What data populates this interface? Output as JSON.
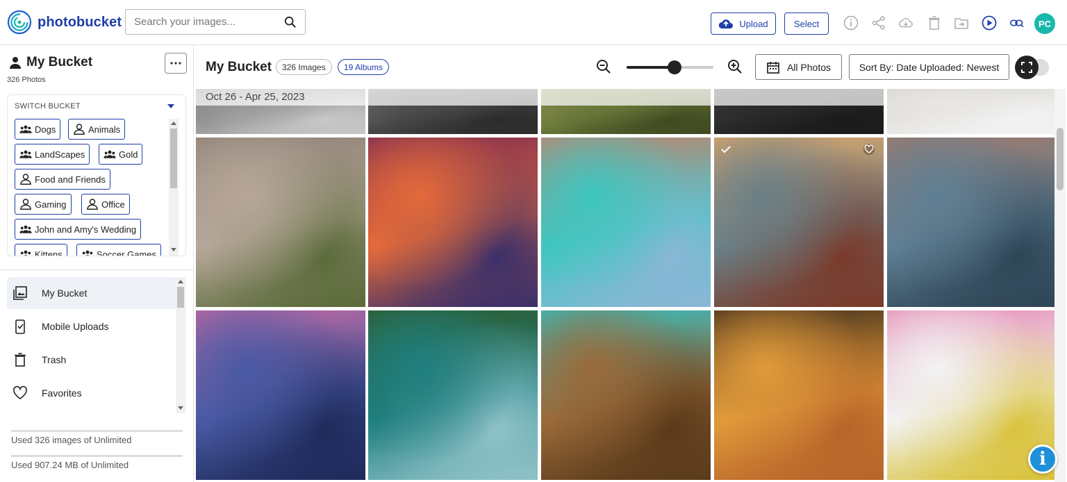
{
  "header": {
    "brand": "photobucket",
    "search_placeholder": "Search your images...",
    "upload_label": "Upload",
    "select_label": "Select",
    "avatar_initials": "PC",
    "toolbar_icons": [
      "info-icon",
      "share-icon",
      "download-icon",
      "trash-icon",
      "move-to-album-icon",
      "slideshow-icon",
      "link-icon"
    ],
    "brand_color": "#1e3fa8",
    "avatar_color": "#19b7ac"
  },
  "sidebar": {
    "title": "My Bucket",
    "photo_count": "326 Photos",
    "switch_label": "SWITCH BUCKET",
    "buckets": [
      {
        "label": "Dogs",
        "icon": "group-icon"
      },
      {
        "label": "Animals",
        "icon": "person-icon"
      },
      {
        "label": "LandScapes",
        "icon": "group-icon"
      },
      {
        "label": "Gold",
        "icon": "group-icon"
      },
      {
        "label": "Food and Friends",
        "icon": "person-icon"
      },
      {
        "label": "Gaming",
        "icon": "person-icon"
      },
      {
        "label": "Office",
        "icon": "person-icon"
      },
      {
        "label": "John and Amy's Wedding",
        "icon": "group-icon"
      },
      {
        "label": "Kittens",
        "icon": "group-icon"
      },
      {
        "label": "Soccer Games",
        "icon": "group-icon"
      }
    ],
    "nav": [
      {
        "label": "My Bucket",
        "icon": "gallery-icon",
        "active": true
      },
      {
        "label": "Mobile Uploads",
        "icon": "mobile-upload-icon",
        "active": false
      },
      {
        "label": "Trash",
        "icon": "trash-icon",
        "active": false
      },
      {
        "label": "Favorites",
        "icon": "heart-icon",
        "active": false
      }
    ],
    "usage_images": "Used 326 images of Unlimited",
    "usage_storage": "Used 907.24 MB of Unlimited"
  },
  "main": {
    "title": "My Bucket",
    "images_pill": "326 Images",
    "albums_pill": "19 Albums",
    "zoom_level": 0.55,
    "all_photos_label": "All Photos",
    "sort_label": "Sort By: Date Uploaded: Newest",
    "date_range": "Oct 26 - Apr 25, 2023",
    "photos": [
      {
        "subject": "street-partial",
        "colors": [
          "#9a9a9a",
          "#6b6b6b",
          "#c8c8c8"
        ]
      },
      {
        "subject": "cafe-terrace-partial",
        "colors": [
          "#4a4a4a",
          "#8c8c8c",
          "#2b2b2b"
        ]
      },
      {
        "subject": "meadow-partial",
        "colors": [
          "#6b7a3a",
          "#a5a06a",
          "#3e4a20"
        ]
      },
      {
        "subject": "dark-water-partial",
        "colors": [
          "#2a2a2a",
          "#4b4b4b",
          "#1a1a1a"
        ]
      },
      {
        "subject": "white-wall-partial",
        "colors": [
          "#e8e6e3",
          "#d3d0cc",
          "#f2f2f2"
        ]
      },
      {
        "subject": "seagull",
        "colors": [
          "#b7a79a",
          "#8d7f74",
          "#5b6b3a"
        ]
      },
      {
        "subject": "burano-canal-sunset",
        "colors": [
          "#e36a3a",
          "#7a2a52",
          "#3a2f6a"
        ]
      },
      {
        "subject": "venice-canal-boat",
        "colors": [
          "#3fc6c0",
          "#c9806a",
          "#8ab7d6"
        ]
      },
      {
        "subject": "pizza-venice-table",
        "colors": [
          "#6a7f86",
          "#e2a86a",
          "#7a3a2a"
        ]
      },
      {
        "subject": "venice-grand-canal",
        "colors": [
          "#5f7f94",
          "#a37a6a",
          "#2e4556"
        ]
      },
      {
        "subject": "sea-dusk-purple",
        "colors": [
          "#4a5aa5",
          "#c46aa0",
          "#1e2a5a"
        ]
      },
      {
        "subject": "lake-kayak-forest",
        "colors": [
          "#1f7f7f",
          "#2e5a2a",
          "#8fc2c9"
        ]
      },
      {
        "subject": "rock-arch-beach",
        "colors": [
          "#9a6a3a",
          "#2fc1c6",
          "#5a3a1a"
        ]
      },
      {
        "subject": "sunset-splash-person",
        "colors": [
          "#e09a3a",
          "#3a2a1a",
          "#b8642a"
        ]
      },
      {
        "subject": "pink-flowers",
        "colors": [
          "#f2f2f2",
          "#e58ab3",
          "#d9c23a"
        ]
      }
    ]
  }
}
